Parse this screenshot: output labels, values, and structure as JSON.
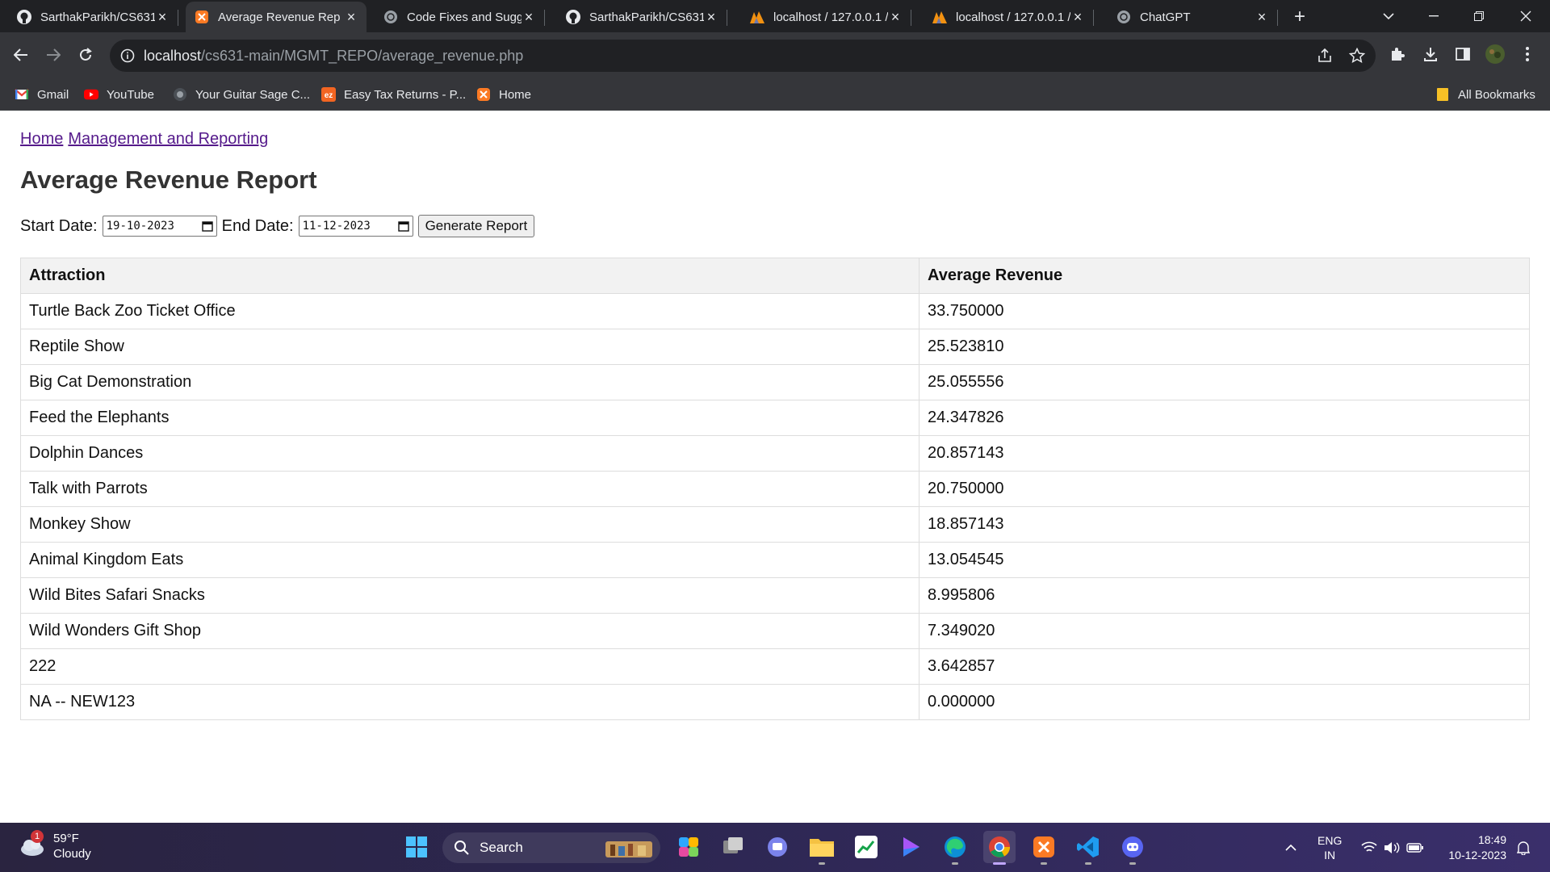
{
  "tabs": [
    {
      "label": "SarthakParikh/CS631",
      "icon": "github-icon",
      "active": false
    },
    {
      "label": "Average Revenue Rep",
      "icon": "xampp-icon",
      "active": true
    },
    {
      "label": "Code Fixes and Sugg",
      "icon": "chatgpt-icon",
      "active": false
    },
    {
      "label": "SarthakParikh/CS631",
      "icon": "github-icon",
      "active": false
    },
    {
      "label": "localhost / 127.0.0.1 /",
      "icon": "phpmyadmin-icon",
      "active": false
    },
    {
      "label": "localhost / 127.0.0.1 /",
      "icon": "phpmyadmin-icon",
      "active": false
    },
    {
      "label": "ChatGPT",
      "icon": "chatgpt-icon",
      "active": false
    }
  ],
  "address": {
    "host": "localhost",
    "path": "/cs631-main/MGMT_REPO/average_revenue.php"
  },
  "bookmarks": {
    "items": [
      {
        "label": "Gmail",
        "icon": "gmail-icon"
      },
      {
        "label": "YouTube",
        "icon": "youtube-icon"
      },
      {
        "label": "Your Guitar Sage C...",
        "icon": "guitar-sage-icon"
      },
      {
        "label": "Easy Tax Returns - P...",
        "icon": "ez-icon"
      },
      {
        "label": "Home",
        "icon": "xampp-icon"
      }
    ],
    "all_label": "All Bookmarks"
  },
  "page": {
    "breadcrumb": {
      "home": "Home",
      "section": "Management and Reporting"
    },
    "title": "Average Revenue Report",
    "start_label": "Start Date:",
    "start_value": "19-10-2023",
    "end_label": "End Date:",
    "end_value": "11-12-2023",
    "generate_label": "Generate Report"
  },
  "table": {
    "headers": [
      "Attraction",
      "Average Revenue"
    ],
    "rows": [
      [
        "Turtle Back Zoo Ticket Office",
        "33.750000"
      ],
      [
        "Reptile Show",
        "25.523810"
      ],
      [
        "Big Cat Demonstration",
        "25.055556"
      ],
      [
        "Feed the Elephants",
        "24.347826"
      ],
      [
        "Dolphin Dances",
        "20.857143"
      ],
      [
        "Talk with Parrots",
        "20.750000"
      ],
      [
        "Monkey Show",
        "18.857143"
      ],
      [
        "Animal Kingdom Eats",
        "13.054545"
      ],
      [
        "Wild Bites Safari Snacks",
        "8.995806"
      ],
      [
        "Wild Wonders Gift Shop",
        "7.349020"
      ],
      [
        "222",
        "3.642857"
      ],
      [
        "NA -- NEW123",
        "0.000000"
      ]
    ]
  },
  "taskbar": {
    "weather_temp": "59°F",
    "weather_desc": "Cloudy",
    "weather_badge": "1",
    "search_label": "Search",
    "lang_line1": "ENG",
    "lang_line2": "IN",
    "time": "18:49",
    "date": "10-12-2023"
  }
}
